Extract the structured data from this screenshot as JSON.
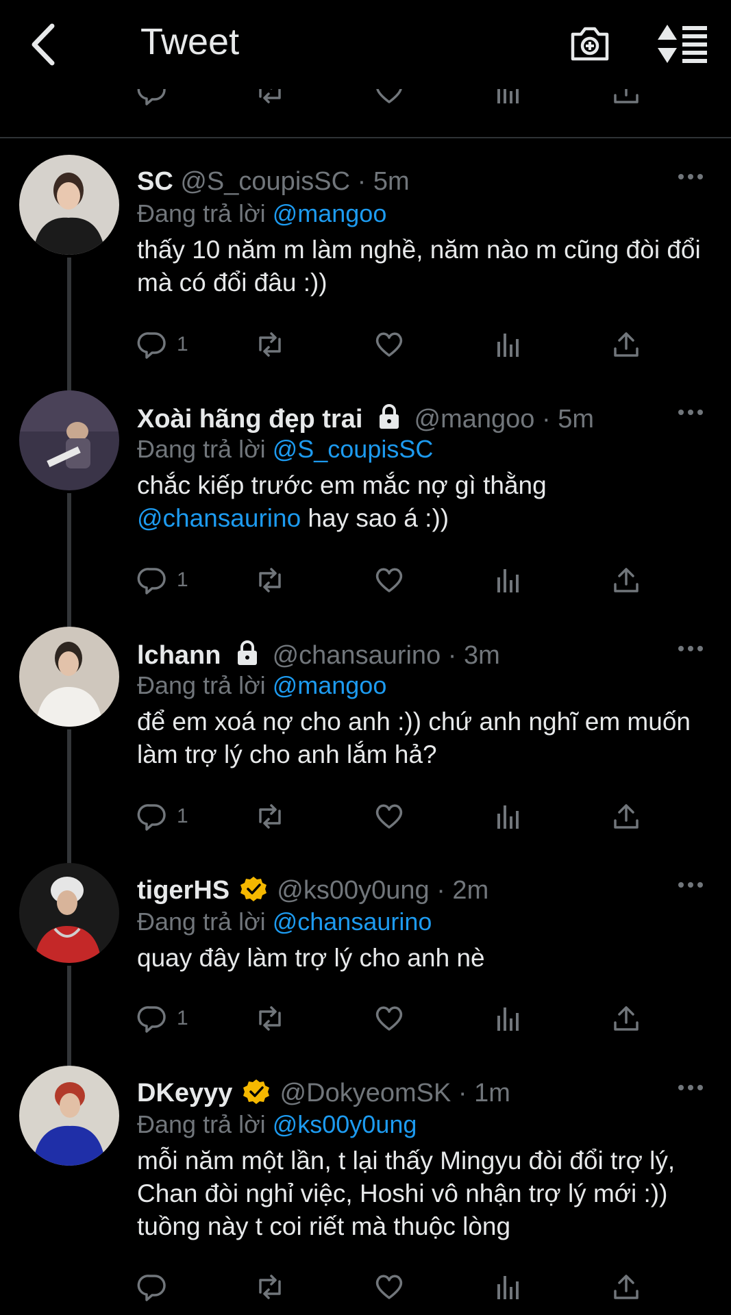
{
  "header": {
    "title": "Tweet"
  },
  "tweets": [
    {
      "name": "SC",
      "handle": "@S_coupisSC",
      "time": "· 5m",
      "reply_prefix": "Đang trả lời",
      "reply_to": "@mangoo",
      "text": "thấy 10 năm m làm nghề, năm nào m cũng đòi đổi mà có đổi đâu :))",
      "replies": "1",
      "locked": false,
      "verified": false
    },
    {
      "name": "Xoài hãng đẹp trai",
      "handle": "@mangoo",
      "time": "· 5m",
      "reply_prefix": "Đang trả lời",
      "reply_to": "@S_coupisSC",
      "text_before": "chắc kiếp trước em mắc nợ gì thằng",
      "text_mention": "@chansaurino",
      "text_after": " hay sao á :))",
      "replies": "1",
      "locked": true,
      "verified": false
    },
    {
      "name": "lchann",
      "handle": "@chansaurino",
      "time": "· 3m",
      "reply_prefix": "Đang trả lời",
      "reply_to": "@mangoo",
      "text": "để em xoá nợ cho anh :)) chứ anh nghĩ em muốn làm trợ lý cho anh lắm hả?",
      "replies": "1",
      "locked": true,
      "verified": false
    },
    {
      "name": "tigerHS",
      "handle": "@ks00y0ung",
      "time": "· 2m",
      "reply_prefix": "Đang trả lời",
      "reply_to": "@chansaurino",
      "text": "quay đây làm trợ lý cho anh nè",
      "replies": "1",
      "locked": false,
      "verified": true
    },
    {
      "name": "DKeyyy",
      "handle": "@DokyeomSK",
      "time": "· 1m",
      "reply_prefix": "Đang trả lời",
      "reply_to": "@ks00y0ung",
      "text": "mỗi năm một lần, t lại thấy Mingyu đòi đổi trợ lý, Chan đòi nghỉ việc, Hoshi vô nhận trợ lý mới :)) tuồng này t coi riết mà thuộc lòng",
      "replies": "",
      "locked": false,
      "verified": true
    }
  ],
  "colors": {
    "accent": "#1d9bf0",
    "muted": "#71767b",
    "text": "#e7e9ea",
    "gold": "#f5b800"
  },
  "icons": [
    "back-arrow-icon",
    "add-photo-icon",
    "sort-icon",
    "reply-icon",
    "retweet-icon",
    "like-icon",
    "views-icon",
    "share-icon",
    "more-icon",
    "lock-icon",
    "verified-icon"
  ]
}
